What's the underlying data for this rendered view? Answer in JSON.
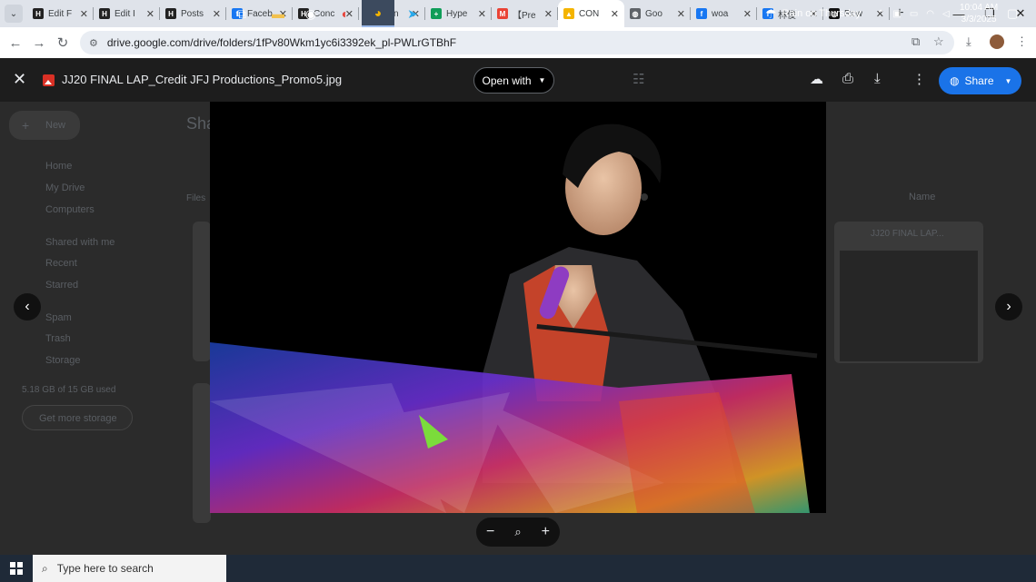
{
  "browser": {
    "tabs": [
      {
        "label": "Edit F",
        "icon": "hyp-logo-icon"
      },
      {
        "label": "Edit I",
        "icon": "hyp-logo-icon"
      },
      {
        "label": "Posts",
        "icon": "hyp-logo-icon"
      },
      {
        "label": "Faceb",
        "icon": "facebook-icon"
      },
      {
        "label": "Conc",
        "icon": "hyp-logo-icon"
      },
      {
        "label": "Chin",
        "icon": "map-pin-icon"
      },
      {
        "label": "Hype",
        "icon": "google-sheets-icon"
      },
      {
        "label": "【Pre",
        "icon": "gmail-icon"
      },
      {
        "label": "CON",
        "icon": "google-drive-icon",
        "active": true
      },
      {
        "label": "Goo",
        "icon": "globe-icon"
      },
      {
        "label": "woa",
        "icon": "facebook-icon"
      },
      {
        "label": "林俊",
        "icon": "facebook-icon"
      },
      {
        "label": "Rew",
        "icon": "openai-icon"
      }
    ],
    "url": "drive.google.com/drive/folders/1fPv80Wkm1yc6i3392ek_pl-PWLrGTBhF"
  },
  "viewer": {
    "filename": "JJ20 FINAL LAP_Credit JFJ Productions_Promo5.jpg",
    "open_with": "Open with",
    "share": "Share"
  },
  "background": {
    "new_label": "New",
    "shared_heading": "Sha",
    "nav": [
      "Home",
      "My Drive",
      "Computers",
      "Shared with me",
      "Recent",
      "Starred",
      "Spam",
      "Trash",
      "Storage"
    ],
    "storage_used": "5.18 GB of 15 GB used",
    "get_storage": "Get more storage",
    "files_label": "Files",
    "sort_label": "Name",
    "file_card_title": "JJ20 FINAL LAP..."
  },
  "taskbar": {
    "search_placeholder": "Type here to search",
    "weather": "Rain on Thursday",
    "time": "10:04 AM",
    "date": "3/3/2025"
  }
}
